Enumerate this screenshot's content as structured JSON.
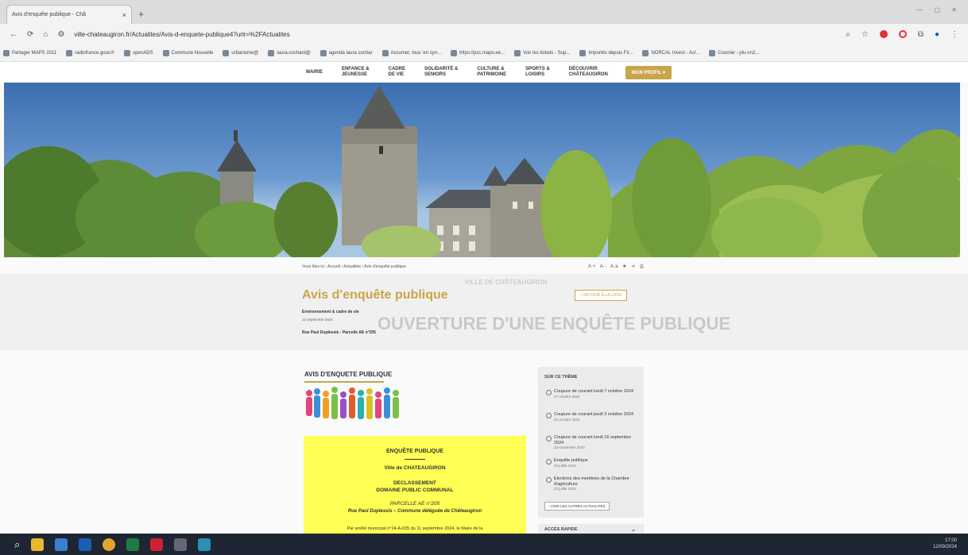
{
  "browser": {
    "tab_title": "Avis d'enquête publique - Châ",
    "tab_close": "×",
    "new_tab": "+",
    "url": "ville-chateaugiron.fr/Actualites/Avis-d-enquete-publique4?urlr=%2FActualites",
    "bookmarks": [
      "Partager MAPS 2011",
      "radiofrance.gouv.fr",
      "openADS",
      "Commune Nouvelle",
      "urbanisme@",
      "laura.cochard@",
      "agenda laura cochar",
      "Assumer, tous 'en syn...",
      "https://pcc.maps.ee...",
      "Voir les tickets - Sup...",
      "Importés depuis Fir...",
      "NORCAL Invest - Acl...",
      "Courrier - plu-nn2..."
    ]
  },
  "site": {
    "nav": [
      {
        "l1": "MAIRIE",
        "l2": ""
      },
      {
        "l1": "ENFANCE &",
        "l2": "JEUNESSE"
      },
      {
        "l1": "CADRE",
        "l2": "DE VIE"
      },
      {
        "l1": "SOLIDARITÉ &",
        "l2": "SENIORS"
      },
      {
        "l1": "CULTURE &",
        "l2": "PATRIMOINE"
      },
      {
        "l1": "SPORTS &",
        "l2": "LOISIRS"
      },
      {
        "l1": "DÉCOUVRIR",
        "l2": "CHÂTEAUGIRON"
      }
    ],
    "profil": "MON PROFIL ▾"
  },
  "breadcrumb": "Vous êtes ici : Accueil › Actualités › Avis d'enquête publique",
  "tools": "A+ A- Aa ★ ⋖ ⎙",
  "page": {
    "title": "Avis d'enquête publique",
    "back_button": "« RETOUR À LA LISTE",
    "category": "Environnement & cadre de vie",
    "date": "12 septembre 2024",
    "subtitle": "Rue Paul Duplessis - Parcelle AE n°205",
    "ghost_big": "OUVERTURE D'UNE ENQUÊTE PUBLIQUE",
    "ghost_small": "VILLE DE CHÂTEAUGIRON"
  },
  "article": {
    "heading": "AVIS D'ENQUETE PUBLIQUE",
    "notice": {
      "l1": "ENQUÊTE PUBLIQUE",
      "l2": "Ville de CHATEAUGIRON",
      "l3": "DECLASSEMENT",
      "l4": "DOMAINE PUBLIC COMMUNAL",
      "l5": "PARCELLE AE n°205",
      "l6": "Rue Paul Duplessis – Commune déléguée de Châteaugiron",
      "l7": "Par arrêté municipal n°24-A-035 du 11 septembre 2024, le Maire de la"
    }
  },
  "sidebar": {
    "heading": "SUR CE THÈME",
    "items": [
      {
        "title": "Coupure de courant lundi 7 octobre 2024",
        "date": "27 octobre 2024"
      },
      {
        "title": "Coupure de courant jeudi 3 octobre 2024",
        "date": "23 octobre 2024"
      },
      {
        "title": "Coupure de courant lundi 16 septembre 2024",
        "date": "13 septembre 2024"
      },
      {
        "title": "Enquête publique",
        "date": "29 juillet 2024"
      },
      {
        "title": "Elections des membres de la Chambre d'agriculture",
        "date": "22 juillet 2024"
      }
    ],
    "all_news": "› VOIR LES AUTRES ACTUALITÉS",
    "quick_access": "ACCÈS RAPIDE",
    "quick_chevron": "⌄"
  },
  "taskbar": {
    "time": "17:00",
    "date": "12/09/2024"
  }
}
